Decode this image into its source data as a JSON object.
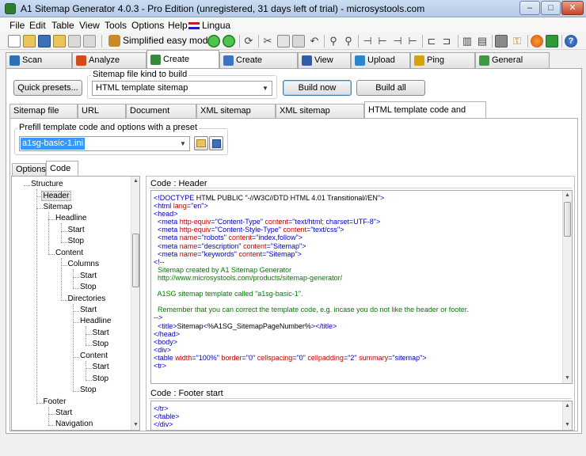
{
  "window": {
    "title": "A1 Sitemap Generator 4.0.3 - Pro Edition (unregistered, 31 days left of trial) - microsystools.com",
    "min": "–",
    "max": "□",
    "close": "✕"
  },
  "menu": [
    "File",
    "Edit",
    "Table",
    "View",
    "Tools",
    "Options",
    "Help"
  ],
  "toolbar": {
    "simplified": "Simplified easy mode",
    "lingua": "Lingua"
  },
  "main_tabs": [
    {
      "label": "Scan website",
      "icon": "globe-scan-icon",
      "color": "#2e6fb6"
    },
    {
      "label": "Analyze website",
      "icon": "analyze-icon",
      "color": "#d04d1b"
    },
    {
      "label": "Create sitemap",
      "icon": "create-sitemap-icon",
      "color": "#3b8a3b"
    },
    {
      "label": "Create robots.txt",
      "icon": "filter-icon",
      "color": "#3c74c2"
    },
    {
      "label": "View files",
      "icon": "view-files-icon",
      "color": "#2f5fa8"
    },
    {
      "label": "Upload files",
      "icon": "upload-icon",
      "color": "#2a87c9"
    },
    {
      "label": "Ping sitemap",
      "icon": "ping-icon",
      "color": "#d8a00b"
    },
    {
      "label": "General options",
      "icon": "general-options-icon",
      "color": "#3e9a3e"
    }
  ],
  "sitemap_kind": {
    "label": "Sitemap file kind to build",
    "value": "HTML template sitemap"
  },
  "buttons": {
    "quick_presets": "Quick presets...",
    "build_now": "Build now",
    "build_all": "Build all"
  },
  "sub_tabs": [
    "Sitemap file paths",
    "URL options",
    "Document options",
    "XML sitemap options",
    "XML sitemap extensions",
    "HTML template code and options"
  ],
  "preset": {
    "label": "Prefill template code and options with a preset",
    "value": "a1sg-basic-1.ini"
  },
  "inner_tabs": [
    "Options",
    "Code"
  ],
  "tree": [
    {
      "label": "Structure",
      "level": 0
    },
    {
      "label": "Header",
      "level": 1
    },
    {
      "label": "Sitemap",
      "level": 1
    },
    {
      "label": "Headline",
      "level": 2
    },
    {
      "label": "Start",
      "level": 3
    },
    {
      "label": "Stop",
      "level": 3
    },
    {
      "label": "Content",
      "level": 2
    },
    {
      "label": "Columns",
      "level": 3
    },
    {
      "label": "Start",
      "level": 4
    },
    {
      "label": "Stop",
      "level": 4
    },
    {
      "label": "Directories",
      "level": 3
    },
    {
      "label": "Start",
      "level": 4
    },
    {
      "label": "Headline",
      "level": 4
    },
    {
      "label": "Start",
      "level": 5
    },
    {
      "label": "Stop",
      "level": 5
    },
    {
      "label": "Content",
      "level": 4
    },
    {
      "label": "Start",
      "level": 5
    },
    {
      "label": "Stop",
      "level": 5
    },
    {
      "label": "Stop",
      "level": 4
    },
    {
      "label": "Footer",
      "level": 1
    },
    {
      "label": "Start",
      "level": 2
    },
    {
      "label": "Navigation",
      "level": 2
    }
  ],
  "code_header": {
    "label": "Code : Header",
    "lines": [
      "<!DOCTYPE HTML PUBLIC \"-//W3C//DTD HTML 4.01 Transitional//EN\">",
      "<html lang=\"en\">",
      "<head>",
      "  <meta http-equiv=\"Content-Type\" content=\"text/html; charset=UTF-8\">",
      "  <meta http-equiv=\"Content-Style-Type\" content=\"text/css\">",
      "  <meta name=\"robots\" content=\"index,follow\">",
      "  <meta name=\"description\" content=\"Sitemap\">",
      "  <meta name=\"keywords\" content=\"Sitemap\">",
      "<!--",
      "  Sitemap created by A1 Sitemap Generator",
      "  http://www.microsystools.com/products/sitemap-generator/",
      "",
      "  A1SG sitemap template called \"a1sg-basic-1\".",
      "",
      "  Remember that you can correct the template code, e.g. incase you do not like the header or footer.",
      "-->",
      "  <title>Sitemap<%A1SG_SitemapPageNumber%></title>",
      "</head>",
      "<body>",
      "<div>",
      "<table width=\"100%\" border=\"0\" cellspacing=\"0\" cellpadding=\"2\" summary=\"sitemap\">",
      "<tr>"
    ]
  },
  "code_footer": {
    "label": "Code : Footer start",
    "lines": [
      "</tr>",
      "</table>",
      "</div>"
    ]
  }
}
